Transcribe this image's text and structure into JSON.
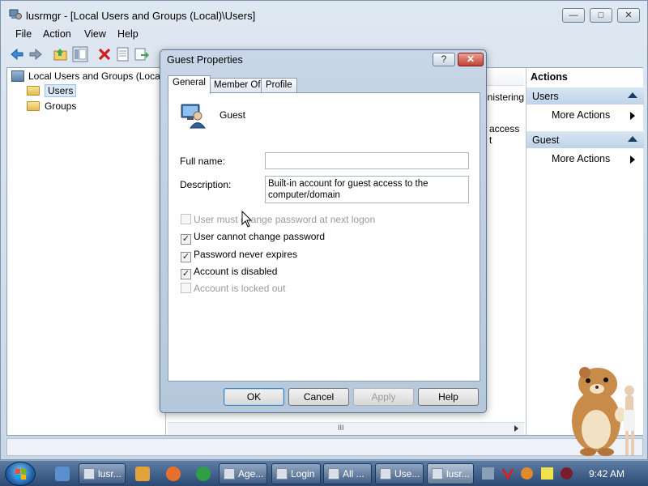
{
  "window": {
    "title": "lusrmgr - [Local Users and Groups (Local)\\Users]",
    "minimize_symbol": "—",
    "maximize_symbol": "□",
    "close_symbol": "✕"
  },
  "menu": [
    "File",
    "Action",
    "View",
    "Help"
  ],
  "toolbar_icons": [
    "back-arrow-icon",
    "forward-arrow-icon",
    "up-folder-icon",
    "show-hide-tree-icon",
    "delete-icon",
    "properties-icon",
    "export-icon"
  ],
  "tree": {
    "root": "Local Users and Groups (Local)",
    "children": [
      "Users",
      "Groups"
    ]
  },
  "list_peek": [
    "inistering",
    "access t"
  ],
  "actions": {
    "title": "Actions",
    "sections": [
      {
        "label": "Users",
        "item": "More Actions"
      },
      {
        "label": "Guest",
        "item": "More Actions"
      }
    ]
  },
  "scrollbar_grip": "III",
  "dialog": {
    "title": "Guest Properties",
    "help_symbol": "?",
    "close_symbol": "✕",
    "tabs": [
      "General",
      "Member Of",
      "Profile"
    ],
    "active_tab": "General",
    "username": "Guest",
    "full_name_label": "Full name:",
    "full_name_value": "",
    "description_label": "Description:",
    "description_value": "Built-in account for guest access to the computer/domain",
    "options": [
      {
        "label": "User must change password at next logon",
        "checked": false,
        "enabled": false
      },
      {
        "label": "User cannot change password",
        "checked": true,
        "enabled": true
      },
      {
        "label": "Password never expires",
        "checked": true,
        "enabled": true
      },
      {
        "label": "Account is disabled",
        "checked": true,
        "enabled": true
      },
      {
        "label": "Account is locked out",
        "checked": false,
        "enabled": false
      }
    ],
    "check_mark": "✓",
    "buttons": {
      "ok": "OK",
      "cancel": "Cancel",
      "apply": "Apply",
      "help": "Help"
    }
  },
  "taskbar": {
    "tasks": [
      "lusr...",
      "Age...",
      "Login",
      "All ...",
      "Use...",
      "lusr..."
    ],
    "clock": "9:42 AM"
  },
  "colors": {
    "accent": "#3c7fb1",
    "taskbar": "#2a4a74",
    "close_red": "#c3422e"
  }
}
